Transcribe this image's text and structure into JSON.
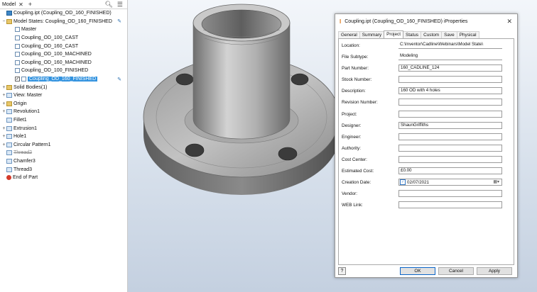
{
  "browser": {
    "tab_label": "Model",
    "close_glyph": "✕",
    "add_glyph": "+",
    "tree": [
      {
        "label": "Coupling.ipt (Coupling_OD_160_FINISHED)",
        "icon": "part-icon",
        "indent": 0,
        "expand": ""
      },
      {
        "label": "Model States: Coupling_OD_160_FINISHED",
        "icon": "folder-icon",
        "indent": 0,
        "expand": "−",
        "pencil": true
      },
      {
        "label": "Master",
        "icon": "model-state-icon",
        "indent": 1,
        "expand": ""
      },
      {
        "label": "Coupling_OD_100_CAST",
        "icon": "model-state-icon",
        "indent": 1,
        "expand": ""
      },
      {
        "label": "Coupling_OD_160_CAST",
        "icon": "model-state-icon",
        "indent": 1,
        "expand": ""
      },
      {
        "label": "Coupling_OD_100_MACHINED",
        "icon": "model-state-icon",
        "indent": 1,
        "expand": ""
      },
      {
        "label": "Coupling_OD_160_MACHINED",
        "icon": "model-state-icon",
        "indent": 1,
        "expand": ""
      },
      {
        "label": "Coupling_OD_100_FINISHED",
        "icon": "model-state-icon",
        "indent": 1,
        "expand": ""
      },
      {
        "label": "Coupling_OD_160_FINISHED",
        "icon": "model-state-icon",
        "indent": 1,
        "expand": "",
        "selected": true,
        "check": true,
        "pencil": true
      },
      {
        "label": "Solid Bodies(1)",
        "icon": "folder-icon",
        "indent": 0,
        "expand": "+"
      },
      {
        "label": "View: Master",
        "icon": "view-icon",
        "indent": 0,
        "expand": "+"
      },
      {
        "label": "Origin",
        "icon": "folder-icon",
        "indent": 0,
        "expand": "+"
      },
      {
        "label": "Revolution1",
        "icon": "revolve-icon",
        "indent": 0,
        "expand": "+"
      },
      {
        "label": "Fillet1",
        "icon": "fillet-icon",
        "indent": 0,
        "expand": ""
      },
      {
        "label": "Extrusion1",
        "icon": "extrude-icon",
        "indent": 0,
        "expand": "+"
      },
      {
        "label": "Hole1",
        "icon": "hole-icon",
        "indent": 0,
        "expand": "+"
      },
      {
        "label": "Circular Pattern1",
        "icon": "circular-pattern-icon",
        "indent": 0,
        "expand": "+"
      },
      {
        "label": "Thread2",
        "icon": "thread-icon",
        "indent": 0,
        "expand": "",
        "suppressed": true
      },
      {
        "label": "Chamfer3",
        "icon": "chamfer-icon",
        "indent": 0,
        "expand": ""
      },
      {
        "label": "Thread3",
        "icon": "thread-icon",
        "indent": 0,
        "expand": ""
      },
      {
        "label": "End of Part",
        "icon": "end-of-part-icon",
        "indent": 0,
        "expand": ""
      }
    ]
  },
  "dialog": {
    "title": "Coupling.ipt (Coupling_OD_160_FINISHED) iProperties",
    "close_glyph": "✕",
    "tabs": [
      "General",
      "Summary",
      "Project",
      "Status",
      "Custom",
      "Save",
      "Physical"
    ],
    "active_tab": "Project",
    "fields": [
      {
        "label": "Location:",
        "value": "C:\\Inventor\\Cadline\\Webinars\\Model State\\",
        "style": "lined"
      },
      {
        "label": "File Subtype:",
        "value": "Modeling",
        "style": "lined"
      },
      {
        "label": "Part Number:",
        "value": "160_CADLINE_124",
        "style": "box"
      },
      {
        "label": "Stock Number:",
        "value": "",
        "style": "box"
      },
      {
        "label": "Description:",
        "value": "160 OD with 4 holes",
        "style": "box"
      },
      {
        "label": "Revision Number:",
        "value": "",
        "style": "box"
      },
      {
        "label": "Project:",
        "value": "",
        "style": "box"
      },
      {
        "label": "Designer:",
        "value": "ShaunGriffiths",
        "style": "box"
      },
      {
        "label": "Engineer:",
        "value": "",
        "style": "box"
      },
      {
        "label": "Authority:",
        "value": "",
        "style": "box"
      },
      {
        "label": "Cost Center:",
        "value": "",
        "style": "box"
      },
      {
        "label": "Estimated Cost:",
        "value": "£0.00",
        "style": "box"
      },
      {
        "label": "Creation Date:",
        "value": "02/07/2021",
        "style": "date"
      },
      {
        "label": "Vendor:",
        "value": "",
        "style": "box"
      },
      {
        "label": "WEB Link:",
        "value": "",
        "style": "box"
      }
    ],
    "buttons": {
      "ok": "OK",
      "cancel": "Cancel",
      "apply": "Apply",
      "help": "?"
    }
  },
  "colors": {
    "selection": "#3393df",
    "viewport_top": "#f3f6fa",
    "viewport_bottom": "#c4d0e0",
    "part_metal": "#8e8e8e"
  }
}
